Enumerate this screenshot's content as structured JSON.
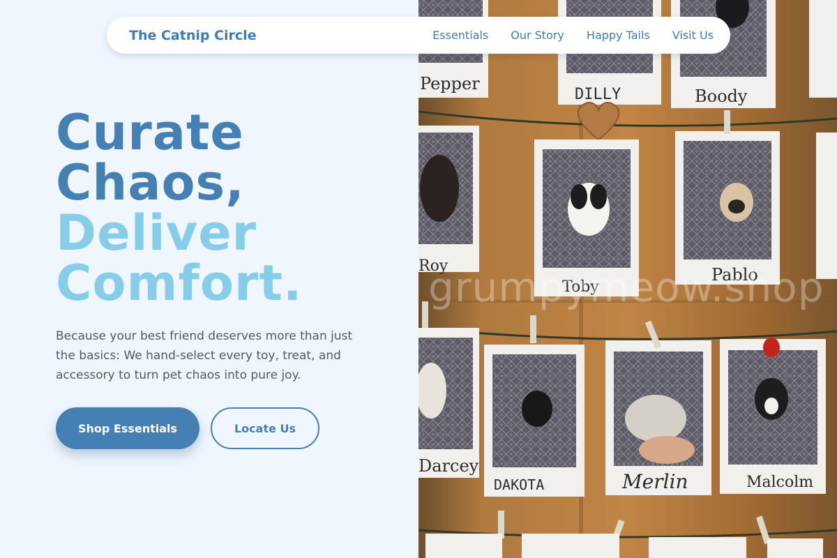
{
  "nav": {
    "brand": "The Catnip Circle",
    "links": [
      {
        "label": "Essentials"
      },
      {
        "label": "Our Story"
      },
      {
        "label": "Happy Tails"
      },
      {
        "label": "Visit Us"
      }
    ]
  },
  "hero": {
    "title_lines": [
      {
        "text": "Curate",
        "tone": "dark"
      },
      {
        "text": "Chaos,",
        "tone": "dark"
      },
      {
        "text": "Deliver",
        "tone": "light"
      },
      {
        "text": "Comfort.",
        "tone": "light"
      }
    ],
    "description": "Because your best friend deserves more than just the basics: We hand-select every toy, treat, and accessory to turn pet chaos into pure joy.",
    "primary_button": "Shop Essentials",
    "secondary_button": "Locate Us"
  },
  "photo": {
    "watermark": "grumpymeow.shop",
    "captions": [
      "Pepper",
      "DILLY",
      "Boody",
      "Roy",
      "Toby",
      "Pablo",
      "Darcey",
      "DAKOTA",
      "Merlin",
      "Malcolm"
    ]
  },
  "colors": {
    "background": "#eff6fd",
    "accent_dark": "#4480b3",
    "accent_light": "#86cdea",
    "body_text": "#4e5a66",
    "wood": "#a4743d"
  }
}
